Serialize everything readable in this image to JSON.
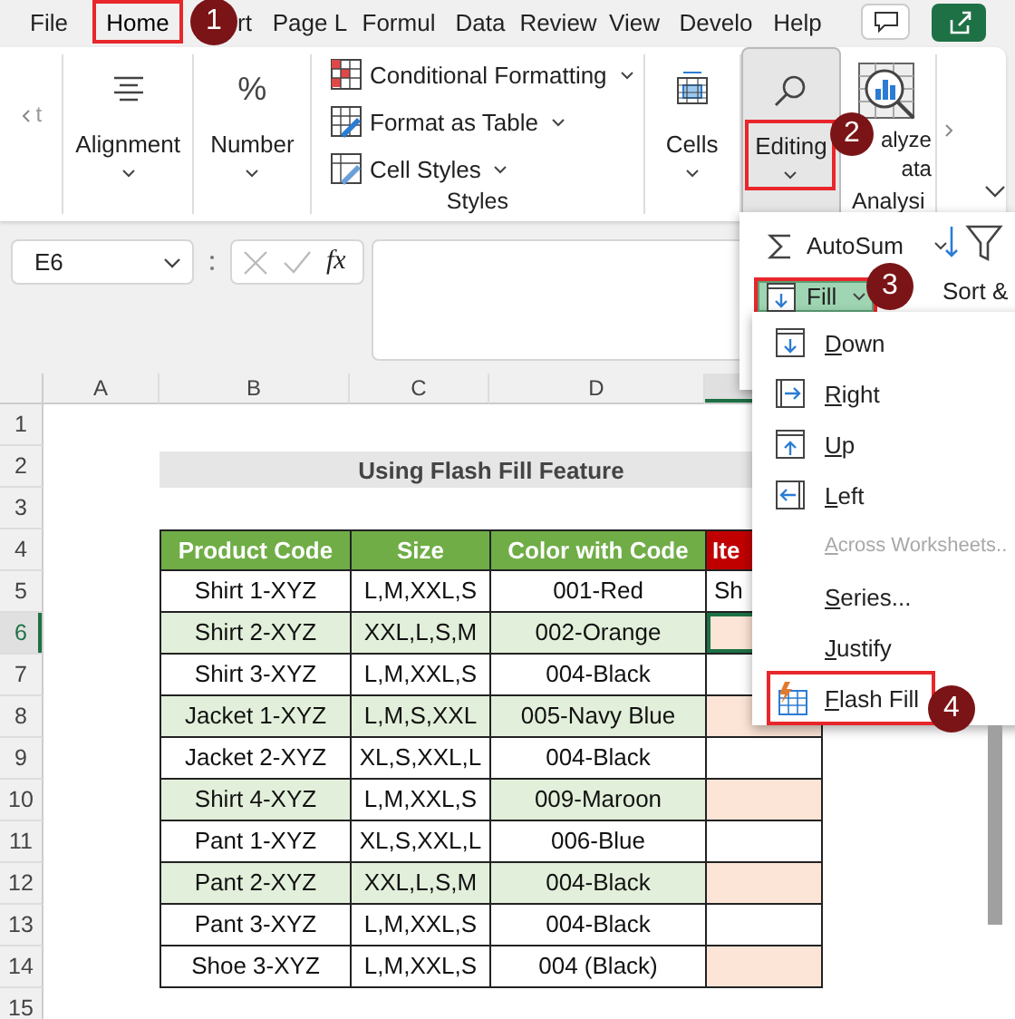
{
  "ribbon_tabs": [
    {
      "label": "File",
      "selected": false,
      "highlighted": false
    },
    {
      "label": "Home",
      "selected": true,
      "highlighted": true
    },
    {
      "label": "rt",
      "selected": false,
      "highlighted": false
    },
    {
      "label": "Page L",
      "selected": false,
      "highlighted": false
    },
    {
      "label": "Formul",
      "selected": false,
      "highlighted": false
    },
    {
      "label": "Data",
      "selected": false,
      "highlighted": false
    },
    {
      "label": "Review",
      "selected": false,
      "highlighted": false
    },
    {
      "label": "View",
      "selected": false,
      "highlighted": false
    },
    {
      "label": "Develo",
      "selected": false,
      "highlighted": false
    },
    {
      "label": "Help",
      "selected": false,
      "highlighted": false
    }
  ],
  "ribbon_groups": [
    {
      "kind": "cut",
      "label": "t"
    },
    {
      "kind": "large",
      "label": "Alignment",
      "expanded": false,
      "highlighted": false
    },
    {
      "kind": "large",
      "icon_text": "%",
      "label": "Number",
      "expanded": false,
      "highlighted": false
    },
    {
      "kind": "stack",
      "group_label": "Styles",
      "items": [
        {
          "label": "Conditional Formatting"
        },
        {
          "label": "Format as Table"
        },
        {
          "label": "Cell Styles"
        }
      ]
    },
    {
      "kind": "large",
      "label": "Cells",
      "expanded": false,
      "highlighted": false
    },
    {
      "kind": "large",
      "label": "Editing",
      "expanded": true,
      "highlighted": true
    },
    {
      "kind": "analyze",
      "lines": [
        "alyze",
        "ata"
      ],
      "group_label": "Analysi"
    }
  ],
  "formula_bar": {
    "name_box": "E6",
    "function_label": "fx"
  },
  "sheet": {
    "columns": [
      {
        "label": "A",
        "selected": false
      },
      {
        "label": "B",
        "selected": false
      },
      {
        "label": "C",
        "selected": false
      },
      {
        "label": "D",
        "selected": false
      },
      {
        "selected": true
      }
    ],
    "rows": [
      {
        "number": "1",
        "selected": false
      },
      {
        "number": "2",
        "selected": false
      },
      {
        "number": "3",
        "selected": false
      },
      {
        "number": "4",
        "selected": false
      },
      {
        "number": "5",
        "selected": false
      },
      {
        "number": "6",
        "selected": true
      },
      {
        "number": "7",
        "selected": false
      },
      {
        "number": "8",
        "selected": false
      },
      {
        "number": "9",
        "selected": false
      },
      {
        "number": "10",
        "selected": false
      },
      {
        "number": "11",
        "selected": false
      },
      {
        "number": "12",
        "selected": false
      },
      {
        "number": "13",
        "selected": false
      },
      {
        "number": "14",
        "selected": false
      },
      {
        "number": "15",
        "selected": false
      }
    ],
    "title": "Using Flash Fill Feature",
    "table": {
      "headers": [
        {
          "label": "Product Code",
          "kind": "green"
        },
        {
          "label": "Size",
          "kind": "green"
        },
        {
          "label": "Color with Code",
          "kind": "green"
        },
        {
          "label": "Ite",
          "kind": "red"
        }
      ],
      "rows": [
        {
          "cells": [
            {
              "text": "Shirt 1-XYZ",
              "shaded": false,
              "selected": false
            },
            {
              "text": "L,M,XXL,S",
              "shaded": false,
              "selected": false
            },
            {
              "text": "001-Red",
              "shaded": false,
              "selected": false
            },
            {
              "text": "Sh",
              "shaded": false,
              "selected": false
            }
          ]
        },
        {
          "cells": [
            {
              "text": "Shirt 2-XYZ",
              "shaded": true,
              "selected": false
            },
            {
              "text": "XXL,L,S,M",
              "shaded": true,
              "selected": false
            },
            {
              "text": "002-Orange",
              "shaded": true,
              "selected": false
            },
            {
              "shaded": true,
              "selected": true
            }
          ]
        },
        {
          "cells": [
            {
              "text": "Shirt 3-XYZ",
              "shaded": false,
              "selected": false
            },
            {
              "text": "L,M,XXL,S",
              "shaded": false,
              "selected": false
            },
            {
              "text": "004-Black",
              "shaded": false,
              "selected": false
            },
            {
              "shaded": false,
              "selected": false
            }
          ]
        },
        {
          "cells": [
            {
              "text": "Jacket 1-XYZ",
              "shaded": true,
              "selected": false
            },
            {
              "text": "L,M,S,XXL",
              "shaded": true,
              "selected": false
            },
            {
              "text": "005-Navy Blue",
              "shaded": true,
              "selected": false
            },
            {
              "shaded": true,
              "selected": false
            }
          ]
        },
        {
          "cells": [
            {
              "text": "Jacket 2-XYZ",
              "shaded": false,
              "selected": false
            },
            {
              "text": "XL,S,XXL,L",
              "shaded": false,
              "selected": false
            },
            {
              "text": "004-Black",
              "shaded": false,
              "selected": false
            },
            {
              "shaded": false,
              "selected": false
            }
          ]
        },
        {
          "cells": [
            {
              "text": "Shirt 4-XYZ",
              "shaded": true,
              "selected": false
            },
            {
              "text": "L,M,XXL,S",
              "shaded": false,
              "selected": false
            },
            {
              "text": "009-Maroon",
              "shaded": true,
              "selected": false
            },
            {
              "shaded": true,
              "selected": false
            }
          ]
        },
        {
          "cells": [
            {
              "text": "Pant 1-XYZ",
              "shaded": false,
              "selected": false
            },
            {
              "text": "XL,S,XXL,L",
              "shaded": false,
              "selected": false
            },
            {
              "text": "006-Blue",
              "shaded": false,
              "selected": false
            },
            {
              "shaded": false,
              "selected": false
            }
          ]
        },
        {
          "cells": [
            {
              "text": "Pant 2-XYZ",
              "shaded": true,
              "selected": false
            },
            {
              "text": "XXL,L,S,M",
              "shaded": true,
              "selected": false
            },
            {
              "text": "004-Black",
              "shaded": true,
              "selected": false
            },
            {
              "shaded": true,
              "selected": false
            }
          ]
        },
        {
          "cells": [
            {
              "text": "Pant 3-XYZ",
              "shaded": false,
              "selected": false
            },
            {
              "text": "L,M,XXL,S",
              "shaded": false,
              "selected": false
            },
            {
              "text": "004-Black",
              "shaded": false,
              "selected": false
            },
            {
              "shaded": false,
              "selected": false
            }
          ]
        },
        {
          "cells": [
            {
              "text": "Shoe 3-XYZ",
              "shaded": false,
              "selected": false
            },
            {
              "text": "L,M,XXL,S",
              "shaded": false,
              "selected": false
            },
            {
              "text": "004 (Black)",
              "shaded": false,
              "selected": false
            },
            {
              "shaded": true,
              "selected": false
            }
          ]
        }
      ]
    }
  },
  "editing_menu": {
    "items": [
      {
        "kind": "autosum",
        "label": "AutoSum",
        "selected": false,
        "highlighted": false
      },
      {
        "kind": "fill",
        "label": "Fill",
        "selected": true,
        "highlighted": true
      }
    ],
    "sort_label": "Sort &"
  },
  "fill_menu": {
    "items": [
      {
        "label": "Down",
        "disabled": false,
        "highlighted": false
      },
      {
        "label": "Right",
        "disabled": false,
        "highlighted": false
      },
      {
        "label": "Up",
        "disabled": false,
        "highlighted": false
      },
      {
        "label": "Left",
        "disabled": false,
        "highlighted": false
      },
      {
        "label": "Across Worksheets..",
        "disabled": true,
        "highlighted": false
      },
      {
        "label": "Series...",
        "disabled": false,
        "highlighted": false
      },
      {
        "label": "Justify",
        "disabled": false,
        "highlighted": false
      },
      {
        "label": "Flash Fill",
        "disabled": false,
        "highlighted": true
      }
    ]
  },
  "steps": [
    {
      "number": "1"
    },
    {
      "number": "2"
    },
    {
      "number": "3"
    },
    {
      "number": "4"
    }
  ]
}
